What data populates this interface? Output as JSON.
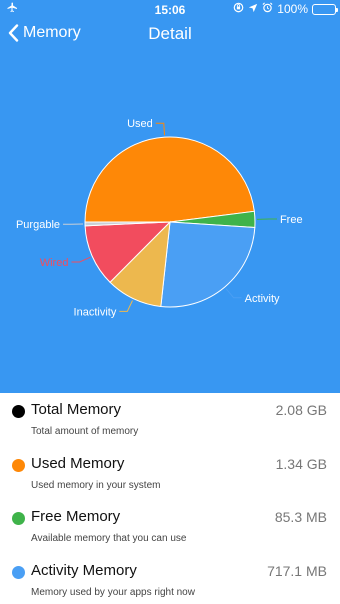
{
  "status_bar": {
    "time": "15:06",
    "battery": "100%",
    "icons": [
      "airplane-icon",
      "orientation-lock-icon",
      "location-icon",
      "alarm-icon",
      "battery-icon"
    ]
  },
  "nav": {
    "back_label": "Memory",
    "title": "Detail"
  },
  "colors": {
    "background": "#3897f2",
    "activity": "#4a9ff4",
    "inactivity": "#edb84e",
    "wired": "#f24c5e",
    "purgable": "#c9cfd6",
    "used": "#fe8807",
    "free": "#3fb34a",
    "total": "#000000"
  },
  "chart_data": {
    "type": "pie",
    "slices": [
      {
        "label": "Used",
        "value": 1.34,
        "color": "#fe8807"
      },
      {
        "label": "Free",
        "value": 0.085,
        "color": "#3fb34a"
      },
      {
        "label": "Activity",
        "value": 0.717,
        "color": "#4a9ff4"
      },
      {
        "label": "Inactivity",
        "value": 0.3,
        "color": "#edb84e"
      },
      {
        "label": "Wired",
        "value": 0.33,
        "color": "#f24c5e"
      },
      {
        "label": "Purgable",
        "value": 0.02,
        "color": "#c9cfd6"
      }
    ]
  },
  "items": [
    {
      "label": "Total Memory",
      "value": "2.08 GB",
      "desc": "Total amount of memory",
      "color": "#000000"
    },
    {
      "label": "Used Memory",
      "value": "1.34 GB",
      "desc": "Used memory in your system",
      "color": "#fe8807"
    },
    {
      "label": "Free Memory",
      "value": "85.3 MB",
      "desc": "Available memory that you can use",
      "color": "#3fb34a"
    },
    {
      "label": "Activity Memory",
      "value": "717.1 MB",
      "desc": "Memory used by your apps right now",
      "color": "#4a9ff4"
    }
  ]
}
